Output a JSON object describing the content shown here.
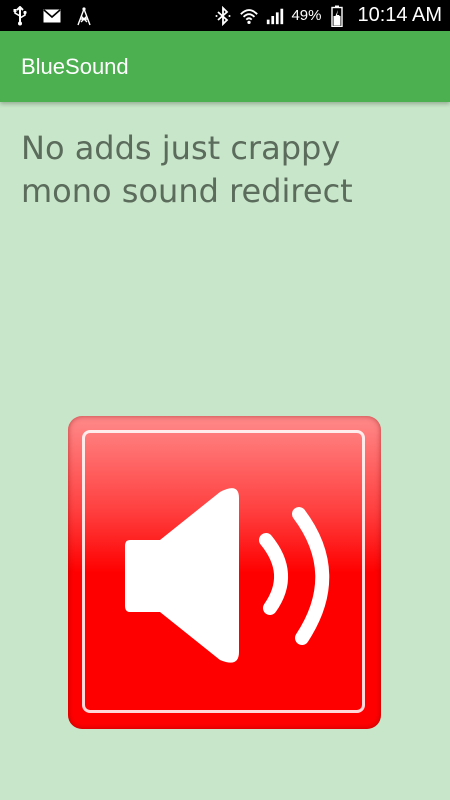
{
  "status_bar": {
    "left_icons": [
      "usb-icon",
      "mail-icon",
      "signal-tower-icon"
    ],
    "right_icons": [
      "bluetooth-icon",
      "wifi-icon",
      "cell-signal-icon",
      "battery-icon"
    ],
    "battery_percent": "49%",
    "time": "10:14 AM"
  },
  "app_bar": {
    "title": "BlueSound"
  },
  "main": {
    "message": "No adds just crappy mono sound redirect"
  },
  "sound_button": {
    "icon": "speaker-volume-icon",
    "colors": {
      "base": "#ff0000",
      "highlight": "#ff8a8a",
      "glyph": "#ffffff"
    }
  },
  "theme": {
    "app_bar_color": "#4caf50",
    "background_color": "#c8e6c9",
    "status_bar_color": "#000000"
  }
}
